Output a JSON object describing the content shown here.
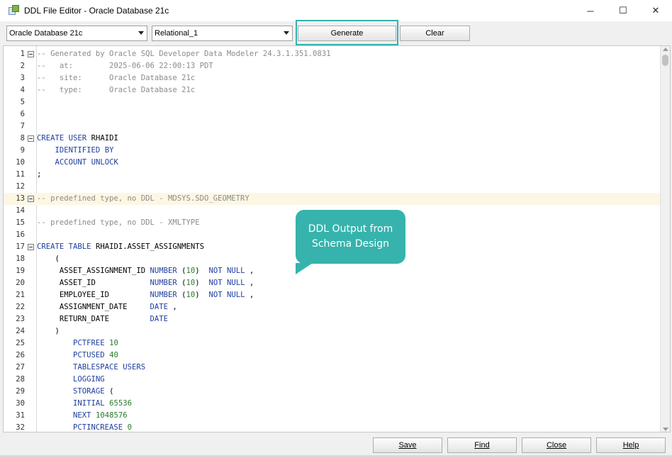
{
  "window": {
    "title": "DDL File Editor - Oracle Database 21c",
    "controls": {
      "minimize": "─",
      "maximize": "☐",
      "close": "✕"
    }
  },
  "toolbar": {
    "database_select": "Oracle Database 21c",
    "model_select": "Relational_1",
    "generate_label": "Generate",
    "clear_label": "Clear"
  },
  "editor": {
    "lines": [
      {
        "n": "1",
        "text": "-- Generated by Oracle SQL Developer Data Modeler 24.3.1.351.0831",
        "kind": "comment",
        "fold": true
      },
      {
        "n": "2",
        "text": "--   at:        2025-06-06 22:00:13 PDT",
        "kind": "comment"
      },
      {
        "n": "3",
        "text": "--   site:      Oracle Database 21c",
        "kind": "comment"
      },
      {
        "n": "4",
        "text": "--   type:      Oracle Database 21c",
        "kind": "comment"
      },
      {
        "n": "5",
        "text": "",
        "kind": "plain"
      },
      {
        "n": "6",
        "text": "",
        "kind": "plain"
      },
      {
        "n": "7",
        "text": "",
        "kind": "plain"
      },
      {
        "n": "8",
        "text": "CREATE USER RHAIDI",
        "kind": "mixed",
        "fold": true
      },
      {
        "n": "9",
        "text": "    IDENTIFIED BY",
        "kind": "kw"
      },
      {
        "n": "10",
        "text": "    ACCOUNT UNLOCK",
        "kind": "kw"
      },
      {
        "n": "11",
        "text": ";",
        "kind": "plain"
      },
      {
        "n": "12",
        "text": "",
        "kind": "plain"
      },
      {
        "n": "13",
        "text": "-- predefined type, no DDL - MDSYS.SDO_GEOMETRY",
        "kind": "comment",
        "fold": true,
        "highlight": true
      },
      {
        "n": "14",
        "text": "",
        "kind": "plain"
      },
      {
        "n": "15",
        "text": "-- predefined type, no DDL - XMLTYPE",
        "kind": "comment"
      },
      {
        "n": "16",
        "text": "",
        "kind": "plain"
      },
      {
        "n": "17",
        "text": "CREATE TABLE RHAIDI.ASSET_ASSIGNMENTS",
        "kind": "mixed",
        "fold": true
      },
      {
        "n": "18",
        "text": "    (",
        "kind": "plain"
      },
      {
        "n": "19",
        "text": "     ASSET_ASSIGNMENT_ID NUMBER (10)  NOT NULL ,",
        "kind": "col"
      },
      {
        "n": "20",
        "text": "     ASSET_ID            NUMBER (10)  NOT NULL ,",
        "kind": "col"
      },
      {
        "n": "21",
        "text": "     EMPLOYEE_ID         NUMBER (10)  NOT NULL ,",
        "kind": "col"
      },
      {
        "n": "22",
        "text": "     ASSIGNMENT_DATE     DATE ,",
        "kind": "col"
      },
      {
        "n": "23",
        "text": "     RETURN_DATE         DATE",
        "kind": "col"
      },
      {
        "n": "24",
        "text": "    )",
        "kind": "plain"
      },
      {
        "n": "25",
        "text": "        PCTFREE 10",
        "kind": "kwnum"
      },
      {
        "n": "26",
        "text": "        PCTUSED 40",
        "kind": "kwnum"
      },
      {
        "n": "27",
        "text": "        TABLESPACE USERS",
        "kind": "kw"
      },
      {
        "n": "28",
        "text": "        LOGGING",
        "kind": "kw"
      },
      {
        "n": "29",
        "text": "        STORAGE (",
        "kind": "kw"
      },
      {
        "n": "30",
        "text": "        INITIAL 65536",
        "kind": "kwnum"
      },
      {
        "n": "31",
        "text": "        NEXT 1048576",
        "kind": "kwnum"
      },
      {
        "n": "32",
        "text": "        PCTINCREASE 0",
        "kind": "kwnum"
      }
    ]
  },
  "callout": {
    "line1": "DDL Output from",
    "line2": "Schema Design"
  },
  "footer": {
    "save_label": "Save",
    "find_label": "Find",
    "close_label": "Close",
    "help_label": "Help"
  },
  "colors": {
    "accent": "#36b3ac",
    "keyword": "#1f3f9e",
    "comment": "#8b8b8b",
    "number": "#2b7a2b",
    "line_highlight": "#fdf6e3"
  }
}
